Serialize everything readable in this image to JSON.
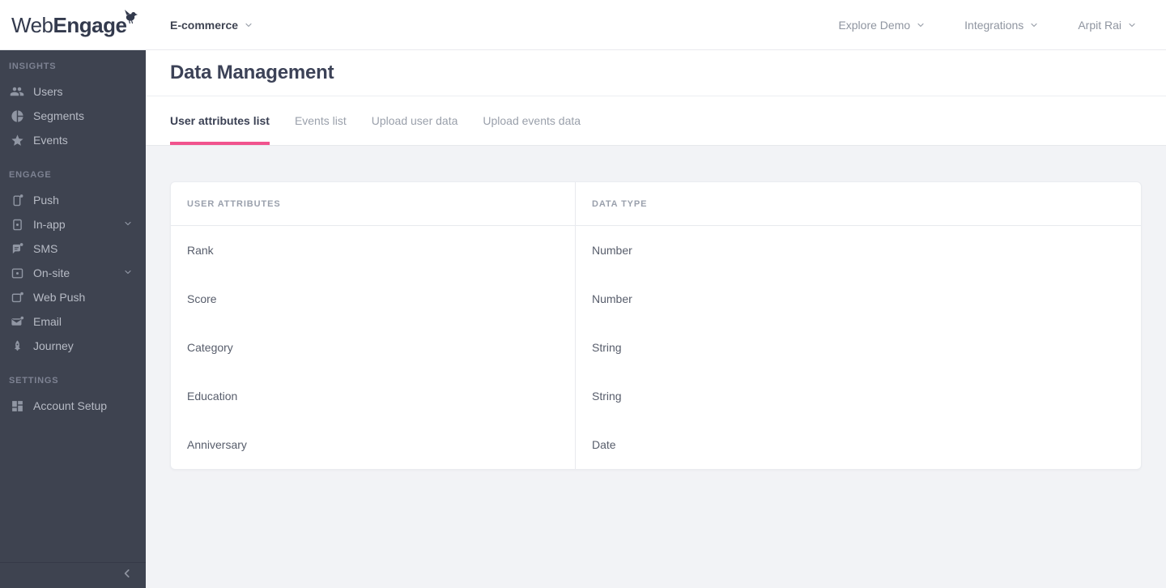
{
  "topbar": {
    "logo": {
      "part1": "Web",
      "part2": "Engage",
      "bird_icon": "bird-icon"
    },
    "project_selector": {
      "label": "E-commerce",
      "icon": "chevron-down-icon"
    },
    "nav": [
      {
        "label": "Explore Demo",
        "icon": "chevron-down-icon"
      },
      {
        "label": "Integrations",
        "icon": "chevron-down-icon"
      },
      {
        "label": "Arpit Rai",
        "icon": "chevron-down-icon"
      }
    ]
  },
  "sidebar": {
    "sections": [
      {
        "title": "INSIGHTS",
        "items": [
          {
            "label": "Users",
            "icon": "users-icon",
            "expandable": false
          },
          {
            "label": "Segments",
            "icon": "segments-icon",
            "expandable": false
          },
          {
            "label": "Events",
            "icon": "events-icon",
            "expandable": false
          }
        ]
      },
      {
        "title": "ENGAGE",
        "items": [
          {
            "label": "Push",
            "icon": "push-icon",
            "expandable": false
          },
          {
            "label": "In-app",
            "icon": "in-app-icon",
            "expandable": true
          },
          {
            "label": "SMS",
            "icon": "sms-icon",
            "expandable": false
          },
          {
            "label": "On-site",
            "icon": "on-site-icon",
            "expandable": true
          },
          {
            "label": "Web Push",
            "icon": "web-push-icon",
            "expandable": false
          },
          {
            "label": "Email",
            "icon": "email-icon",
            "expandable": false
          },
          {
            "label": "Journey",
            "icon": "journey-icon",
            "expandable": false
          }
        ]
      },
      {
        "title": "SETTINGS",
        "items": [
          {
            "label": "Account Setup",
            "icon": "account-setup-icon",
            "expandable": false
          }
        ]
      }
    ],
    "collapse_icon": "chevron-left-icon"
  },
  "page": {
    "title": "Data Management"
  },
  "tabs": [
    {
      "label": "User attributes list",
      "active": true
    },
    {
      "label": "Events list",
      "active": false
    },
    {
      "label": "Upload user data",
      "active": false
    },
    {
      "label": "Upload events data",
      "active": false
    }
  ],
  "table": {
    "columns": [
      "USER ATTRIBUTES",
      "DATA TYPE"
    ],
    "rows": [
      {
        "attribute": "Rank",
        "data_type": "Number"
      },
      {
        "attribute": "Score",
        "data_type": "Number"
      },
      {
        "attribute": "Category",
        "data_type": "String"
      },
      {
        "attribute": "Education",
        "data_type": "String"
      },
      {
        "attribute": "Anniversary",
        "data_type": "Date"
      }
    ]
  },
  "colors": {
    "accent_pink": "#f1538d",
    "sidebar_bg": "#3e4350",
    "page_bg": "#f2f3f6",
    "heading_text": "#3c4257"
  }
}
